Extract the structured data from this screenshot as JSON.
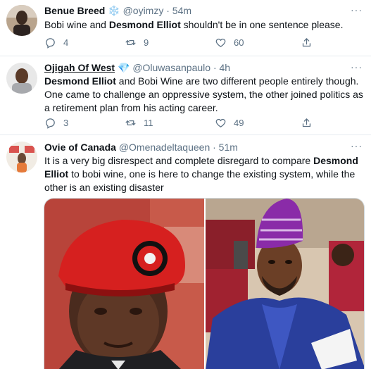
{
  "tweets": [
    {
      "name": "Benue Breed",
      "name_emoji": "❄️",
      "handle": "@oyimzy",
      "time": "· 54m",
      "text_parts": [
        "Bobi wine and ",
        "Desmond Elliot",
        " shouldn't be in one sentence please."
      ],
      "replies": "4",
      "retweets": "9",
      "likes": "60"
    },
    {
      "name": "Ojigah Of West",
      "name_emoji": "💎",
      "handle": "@Oluwasanpaulo",
      "time": "· 4h",
      "text_parts": [
        "Desmond Elliot",
        " and Bobi Wine are two different people entirely though. One came to challenge an oppressive system, the other joined politics as a retirement plan from his acting career."
      ],
      "replies": "3",
      "retweets": "11",
      "likes": "49"
    },
    {
      "name": "Ovie of Canada",
      "handle": "@Omenadeltaqueen",
      "time": "· 51m",
      "text_parts": [
        "It is a very big disrespect and complete disregard to compare ",
        "Desmond Elliot",
        " to bobi wine, one is here to change the existing system, while the other is an existing disaster"
      ]
    }
  ],
  "more_label": "···",
  "icons": [
    "reply-icon",
    "retweet-icon",
    "like-icon",
    "share-icon",
    "more-icon"
  ],
  "colors": {
    "muted": "#5b7083",
    "text": "#0f1419",
    "border": "#e6ecf0",
    "verified_blue": "#1da1f2"
  }
}
